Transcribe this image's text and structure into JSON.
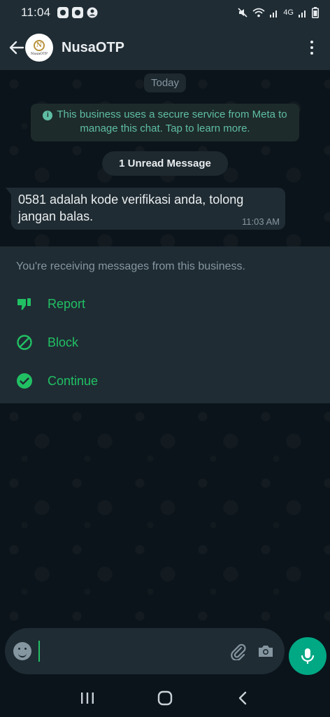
{
  "status_bar": {
    "time": "11:04",
    "network_label": "4G"
  },
  "header": {
    "contact_name": "NusaOTP",
    "avatar_text": "NusaOTP"
  },
  "chat": {
    "date_label": "Today",
    "info_text": "This business uses a secure service from Meta to manage this chat. Tap to learn more.",
    "unread_label": "1 Unread Message",
    "message": {
      "text": "0581 adalah kode verifikasi anda, tolong jangan balas.",
      "time": "11:03 AM"
    }
  },
  "business_panel": {
    "note": "You're receiving messages from this business.",
    "actions": [
      {
        "label": "Report",
        "icon": "thumbs-down-icon"
      },
      {
        "label": "Block",
        "icon": "block-icon"
      },
      {
        "label": "Continue",
        "icon": "check-circle-icon"
      }
    ]
  },
  "input": {
    "value": "",
    "placeholder": ""
  },
  "colors": {
    "accent": "#21c063",
    "fab": "#00a884",
    "header_bg": "#1f2c34",
    "chat_bg": "#0b141a"
  }
}
